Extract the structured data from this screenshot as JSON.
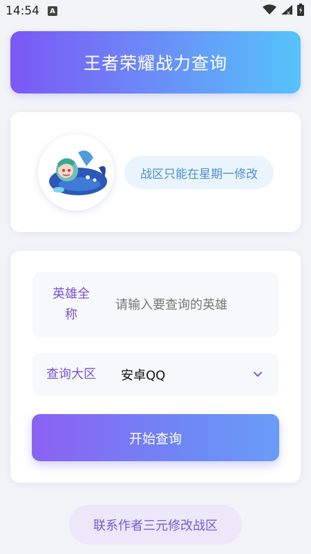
{
  "status_bar": {
    "time": "14:54",
    "notification_icon": "a-icon",
    "wifi_icon": "wifi-icon",
    "signal_icon": "signal-icon",
    "battery_icon": "battery-icon"
  },
  "header": {
    "title": "王者荣耀战力查询"
  },
  "profile": {
    "avatar_icon": "avatar-icon",
    "notice": "战区只能在星期一修改"
  },
  "form": {
    "hero_label": "英雄全称",
    "hero_placeholder": "请输入要查询的英雄",
    "zone_label": "查询大区",
    "zone_value": "安卓QQ",
    "submit_label": "开始查询"
  },
  "contact": {
    "label": "联系作者三元修改战区"
  },
  "colors": {
    "accent_purple": "#7c57f5",
    "accent_blue": "#56c3fb",
    "label_purple": "#7a52d6",
    "notice_blue": "#4f8fcf"
  }
}
